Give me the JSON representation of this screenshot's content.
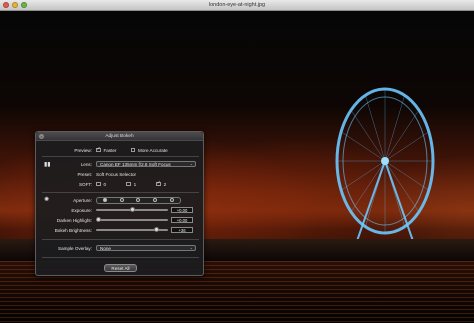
{
  "window": {
    "title": "london-eye-at-night.jpg"
  },
  "panel": {
    "title": "Adjust Bokeh",
    "preview": {
      "label": "Preview:",
      "faster": "Faster",
      "faster_checked": true,
      "accurate": "More Accurate",
      "accurate_checked": false
    },
    "lens": {
      "label": "Lens:",
      "value": "Canon EF 135mm f/2.8 Soft Focus"
    },
    "preset": {
      "label": "Preset:",
      "value": "Soft Focus Selector"
    },
    "soft": {
      "label": "SOFT:",
      "options": [
        "0",
        "1",
        "2"
      ],
      "selected": "2"
    },
    "aperture": {
      "label": "Aperture:"
    },
    "exposure": {
      "label": "Exposure:",
      "value": "+0.00",
      "level": 0.5
    },
    "darken": {
      "label": "Darken Highlight:",
      "value": "+0.00",
      "level": 0.0
    },
    "brightness": {
      "label": "Bokeh Brightness:",
      "value": "+36",
      "level": 0.86
    },
    "overlay": {
      "label": "Sample Overlay:",
      "value": "None"
    },
    "reset": "Reset All"
  },
  "colors": {
    "panel_bg": "#1c1c1e",
    "accent_wheel": "#58b7ff"
  },
  "icons": {
    "close": "close-icon",
    "lens": "lens-icon",
    "aperture": "aperture-icon"
  }
}
